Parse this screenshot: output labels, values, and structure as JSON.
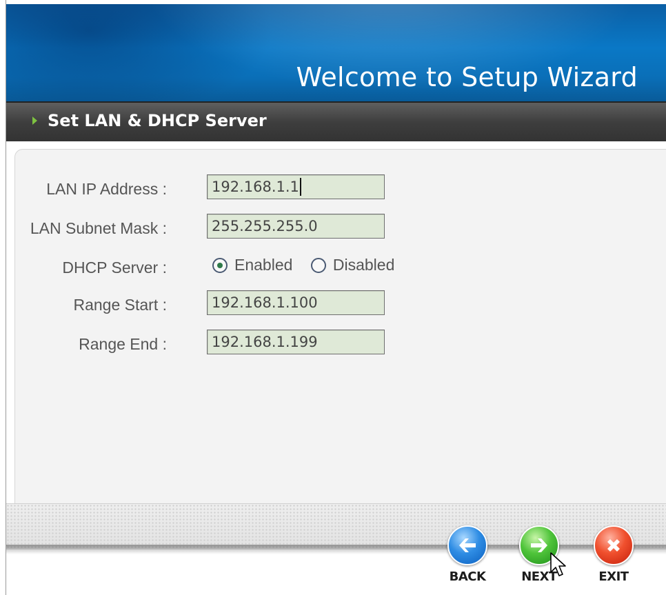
{
  "banner": {
    "title": "Welcome to Setup Wizard"
  },
  "section": {
    "title": "Set LAN & DHCP Server"
  },
  "form": {
    "lan_ip": {
      "label": "LAN IP Address :",
      "value": "192.168.1.1"
    },
    "lan_mask": {
      "label": "LAN Subnet Mask :",
      "value": "255.255.255.0"
    },
    "dhcp": {
      "label": "DHCP Server :",
      "options": [
        "Enabled",
        "Disabled"
      ],
      "selected": "Enabled"
    },
    "range_start": {
      "label": "Range Start :",
      "value": "192.168.1.100"
    },
    "range_end": {
      "label": "Range End :",
      "value": "192.168.1.199"
    }
  },
  "buttons": {
    "back": {
      "label": "BACK",
      "icon": "arrow-left-icon"
    },
    "next": {
      "label": "NEXT",
      "icon": "arrow-right-icon"
    },
    "exit": {
      "label": "EXIT",
      "icon": "close-x-icon"
    }
  },
  "colors": {
    "banner_blue": "#0a78c6",
    "section_bar": "#3e3e3e",
    "field_bg": "#dfe9d7",
    "accent_green": "#7ec241"
  }
}
